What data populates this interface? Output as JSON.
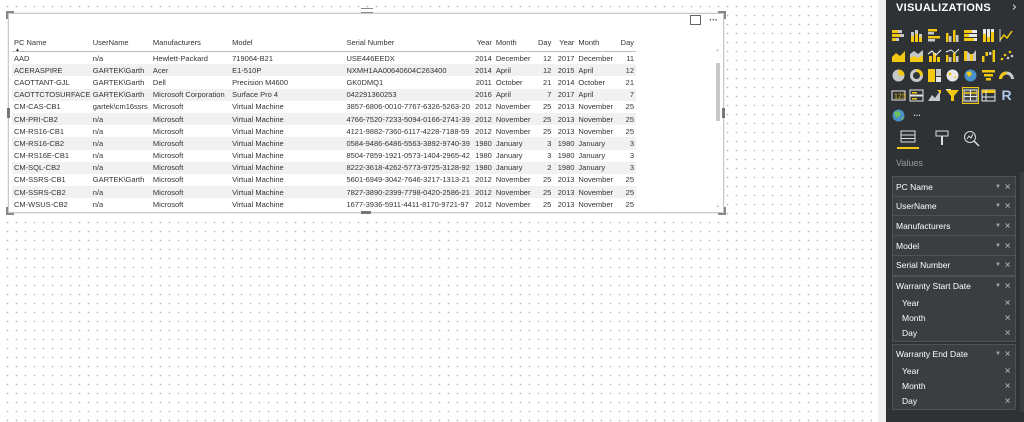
{
  "pane": {
    "title": "VISUALIZATIONS",
    "chevron": "›",
    "values_header": "Values",
    "fields": [
      {
        "label": "PC Name"
      },
      {
        "label": "UserName"
      },
      {
        "label": "Manufacturers"
      },
      {
        "label": "Model"
      },
      {
        "label": "Serial Number"
      }
    ],
    "hierarchies": [
      {
        "label": "Warranty Start Date",
        "levels": [
          "Year",
          "Month",
          "Day"
        ]
      },
      {
        "label": "Warranty End Date",
        "levels": [
          "Year",
          "Month",
          "Day"
        ]
      }
    ],
    "viz_icons": [
      "stacked-bar-icon",
      "stacked-column-icon",
      "clustered-bar-icon",
      "clustered-column-icon",
      "100-stacked-bar-icon",
      "100-stacked-column-icon",
      "line-chart-icon",
      "area-chart-icon",
      "stacked-area-icon",
      "line-column-icon",
      "line-clustered-column-icon",
      "ribbon-chart-icon",
      "waterfall-icon",
      "scatter-icon",
      "pie-icon",
      "donut-icon",
      "treemap-icon",
      "map-icon",
      "filled-map-icon",
      "funnel-icon",
      "gauge-icon",
      "card-icon",
      "multirow-card-icon",
      "kpi-icon",
      "slicer-icon",
      "table-icon",
      "matrix-icon",
      "r-visual-icon",
      "globe-icon",
      "more-icon"
    ],
    "more_label": "···",
    "r_label": "R"
  },
  "accent_color": "#f2c811",
  "visual": {
    "more_label": "···",
    "table": {
      "columns": [
        "PC Name",
        "UserName",
        "Manufacturers",
        "Model",
        "Serial Number",
        "Year",
        "Month",
        "Day",
        "Year",
        "Month",
        "Day"
      ],
      "rows": [
        [
          "AAD",
          "n/a",
          "Hewlett-Packard",
          "719064-B21",
          "USE446EEDX",
          "2014",
          "December",
          "12",
          "2017",
          "December",
          "11"
        ],
        [
          "ACERASPIRE",
          "GARTEK\\Garth",
          "Acer",
          "E1-510P",
          "NXMH1AA00640604C263400",
          "2014",
          "April",
          "12",
          "2015",
          "April",
          "12"
        ],
        [
          "CAOTTANT-GJL",
          "GARTEK\\Garth",
          "Dell",
          "Precision M4600",
          "GK0DMQ1",
          "2011",
          "October",
          "21",
          "2014",
          "October",
          "21"
        ],
        [
          "CAOTTCTOSURFACE",
          "GARTEK\\Garth",
          "Microsoft Corporation",
          "Surface Pro 4",
          "042291360253",
          "2016",
          "April",
          "7",
          "2017",
          "April",
          "7"
        ],
        [
          "CM-CAS-CB1",
          "gartek\\cm16ssrs",
          "Microsoft",
          "Virtual Machine",
          "3857-6806-0010-7767-6326-5263-20",
          "2012",
          "November",
          "25",
          "2013",
          "November",
          "25"
        ],
        [
          "CM-PRI-CB2",
          "n/a",
          "Microsoft",
          "Virtual Machine",
          "4766-7520-7233-5094-0166-2741-39",
          "2012",
          "November",
          "25",
          "2013",
          "November",
          "25"
        ],
        [
          "CM-RS16-CB1",
          "n/a",
          "Microsoft",
          "Virtual Machine",
          "4121-9882-7360-6117-4228-7188-59",
          "2012",
          "November",
          "25",
          "2013",
          "November",
          "25"
        ],
        [
          "CM-RS16-CB2",
          "n/a",
          "Microsoft",
          "Virtual Machine",
          "0584-9486-6486-5563-3892-9740-39",
          "1980",
          "January",
          "3",
          "1980",
          "January",
          "3"
        ],
        [
          "CM-RS16E-CB1",
          "n/a",
          "Microsoft",
          "Virtual Machine",
          "8504-7859-1921-0573-1404-2965-42",
          "1980",
          "January",
          "3",
          "1980",
          "January",
          "3"
        ],
        [
          "CM-SQL-CB2",
          "n/a",
          "Microsoft",
          "Virtual Machine",
          "8222-3618-4262-5773-9725-3128-92",
          "1980",
          "January",
          "2",
          "1980",
          "January",
          "3"
        ],
        [
          "CM-SSRS-CB1",
          "GARTEK\\Garth",
          "Microsoft",
          "Virtual Machine",
          "5601-6949-3042-7646-3217-1313-21",
          "2012",
          "November",
          "25",
          "2013",
          "November",
          "25"
        ],
        [
          "CM-SSRS-CB2",
          "n/a",
          "Microsoft",
          "Virtual Machine",
          "7827-3890-2399-7798-0420-2586-21",
          "2012",
          "November",
          "25",
          "2013",
          "November",
          "25"
        ],
        [
          "CM-WSUS-CB2",
          "n/a",
          "Microsoft",
          "Virtual Machine",
          "1677-3936-5911-4411-8170-9721-97",
          "2012",
          "November",
          "25",
          "2013",
          "November",
          "25"
        ]
      ]
    }
  }
}
